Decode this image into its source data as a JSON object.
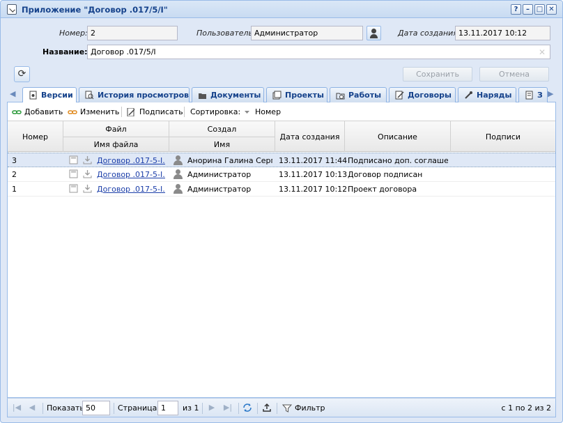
{
  "window": {
    "title": "Приложение \"Договор .017/5/I\"",
    "buttons": [
      "?",
      "–",
      "□",
      "✕"
    ]
  },
  "form": {
    "number_label": "Номер:",
    "number_value": "2",
    "user_label": "Пользователь:",
    "user_value": "Администратор",
    "created_label": "Дата создания:",
    "created_value": "13.11.2017 10:12",
    "name_label": "Название:",
    "name_value": "Договор .017/5/I",
    "save_label": "Сохранить",
    "cancel_label": "Отмена"
  },
  "tabs": [
    {
      "label": "Версии",
      "icon": "versions-icon",
      "active": true
    },
    {
      "label": "История просмотров",
      "icon": "history-icon",
      "active": false
    },
    {
      "label": "Документы",
      "icon": "documents-icon",
      "active": false
    },
    {
      "label": "Проекты",
      "icon": "projects-icon",
      "active": false
    },
    {
      "label": "Работы",
      "icon": "works-icon",
      "active": false
    },
    {
      "label": "Договоры",
      "icon": "contracts-icon",
      "active": false
    },
    {
      "label": "Наряды",
      "icon": "orders-icon",
      "active": false
    },
    {
      "label": "З",
      "icon": "more-icon",
      "active": false
    }
  ],
  "toolbar": {
    "add_label": "Добавить",
    "edit_label": "Изменить",
    "sign_label": "Подписать",
    "sort_label": "Сортировка:",
    "sort_field": "Номер"
  },
  "grid": {
    "headers": {
      "number": "Номер",
      "file_group": "Файл",
      "file_name": "Имя файла",
      "creator_group": "Создал",
      "creator_name": "Имя",
      "created": "Дата создания",
      "description": "Описание",
      "signatures": "Подписи"
    },
    "rows": [
      {
        "number": "3",
        "file": "Договор .017-5-I...",
        "creator": "Анорина Галина Серг...",
        "created": "13.11.2017 11:44",
        "description": "Подписано доп. соглаше...",
        "signatures": "",
        "selected": true
      },
      {
        "number": "2",
        "file": "Договор .017-5-I...",
        "creator": "Администратор",
        "created": "13.11.2017 10:13",
        "description": "Договор подписан",
        "signatures": "",
        "selected": false
      },
      {
        "number": "1",
        "file": "Договор .017-5-I...",
        "creator": "Администратор",
        "created": "13.11.2017 10:12",
        "description": "Проект договора",
        "signatures": "",
        "selected": false
      }
    ]
  },
  "pager": {
    "show_label": "Показать",
    "page_size": "50",
    "page_label": "Страница",
    "page_value": "1",
    "of_label": "из 1",
    "filter_label": "Фильтр",
    "summary": "с 1 по 2 из 2"
  },
  "colors": {
    "frame": "#99bbe8",
    "panel": "#dfe8f6",
    "title": "#15428b",
    "link": "#1a3da8"
  }
}
